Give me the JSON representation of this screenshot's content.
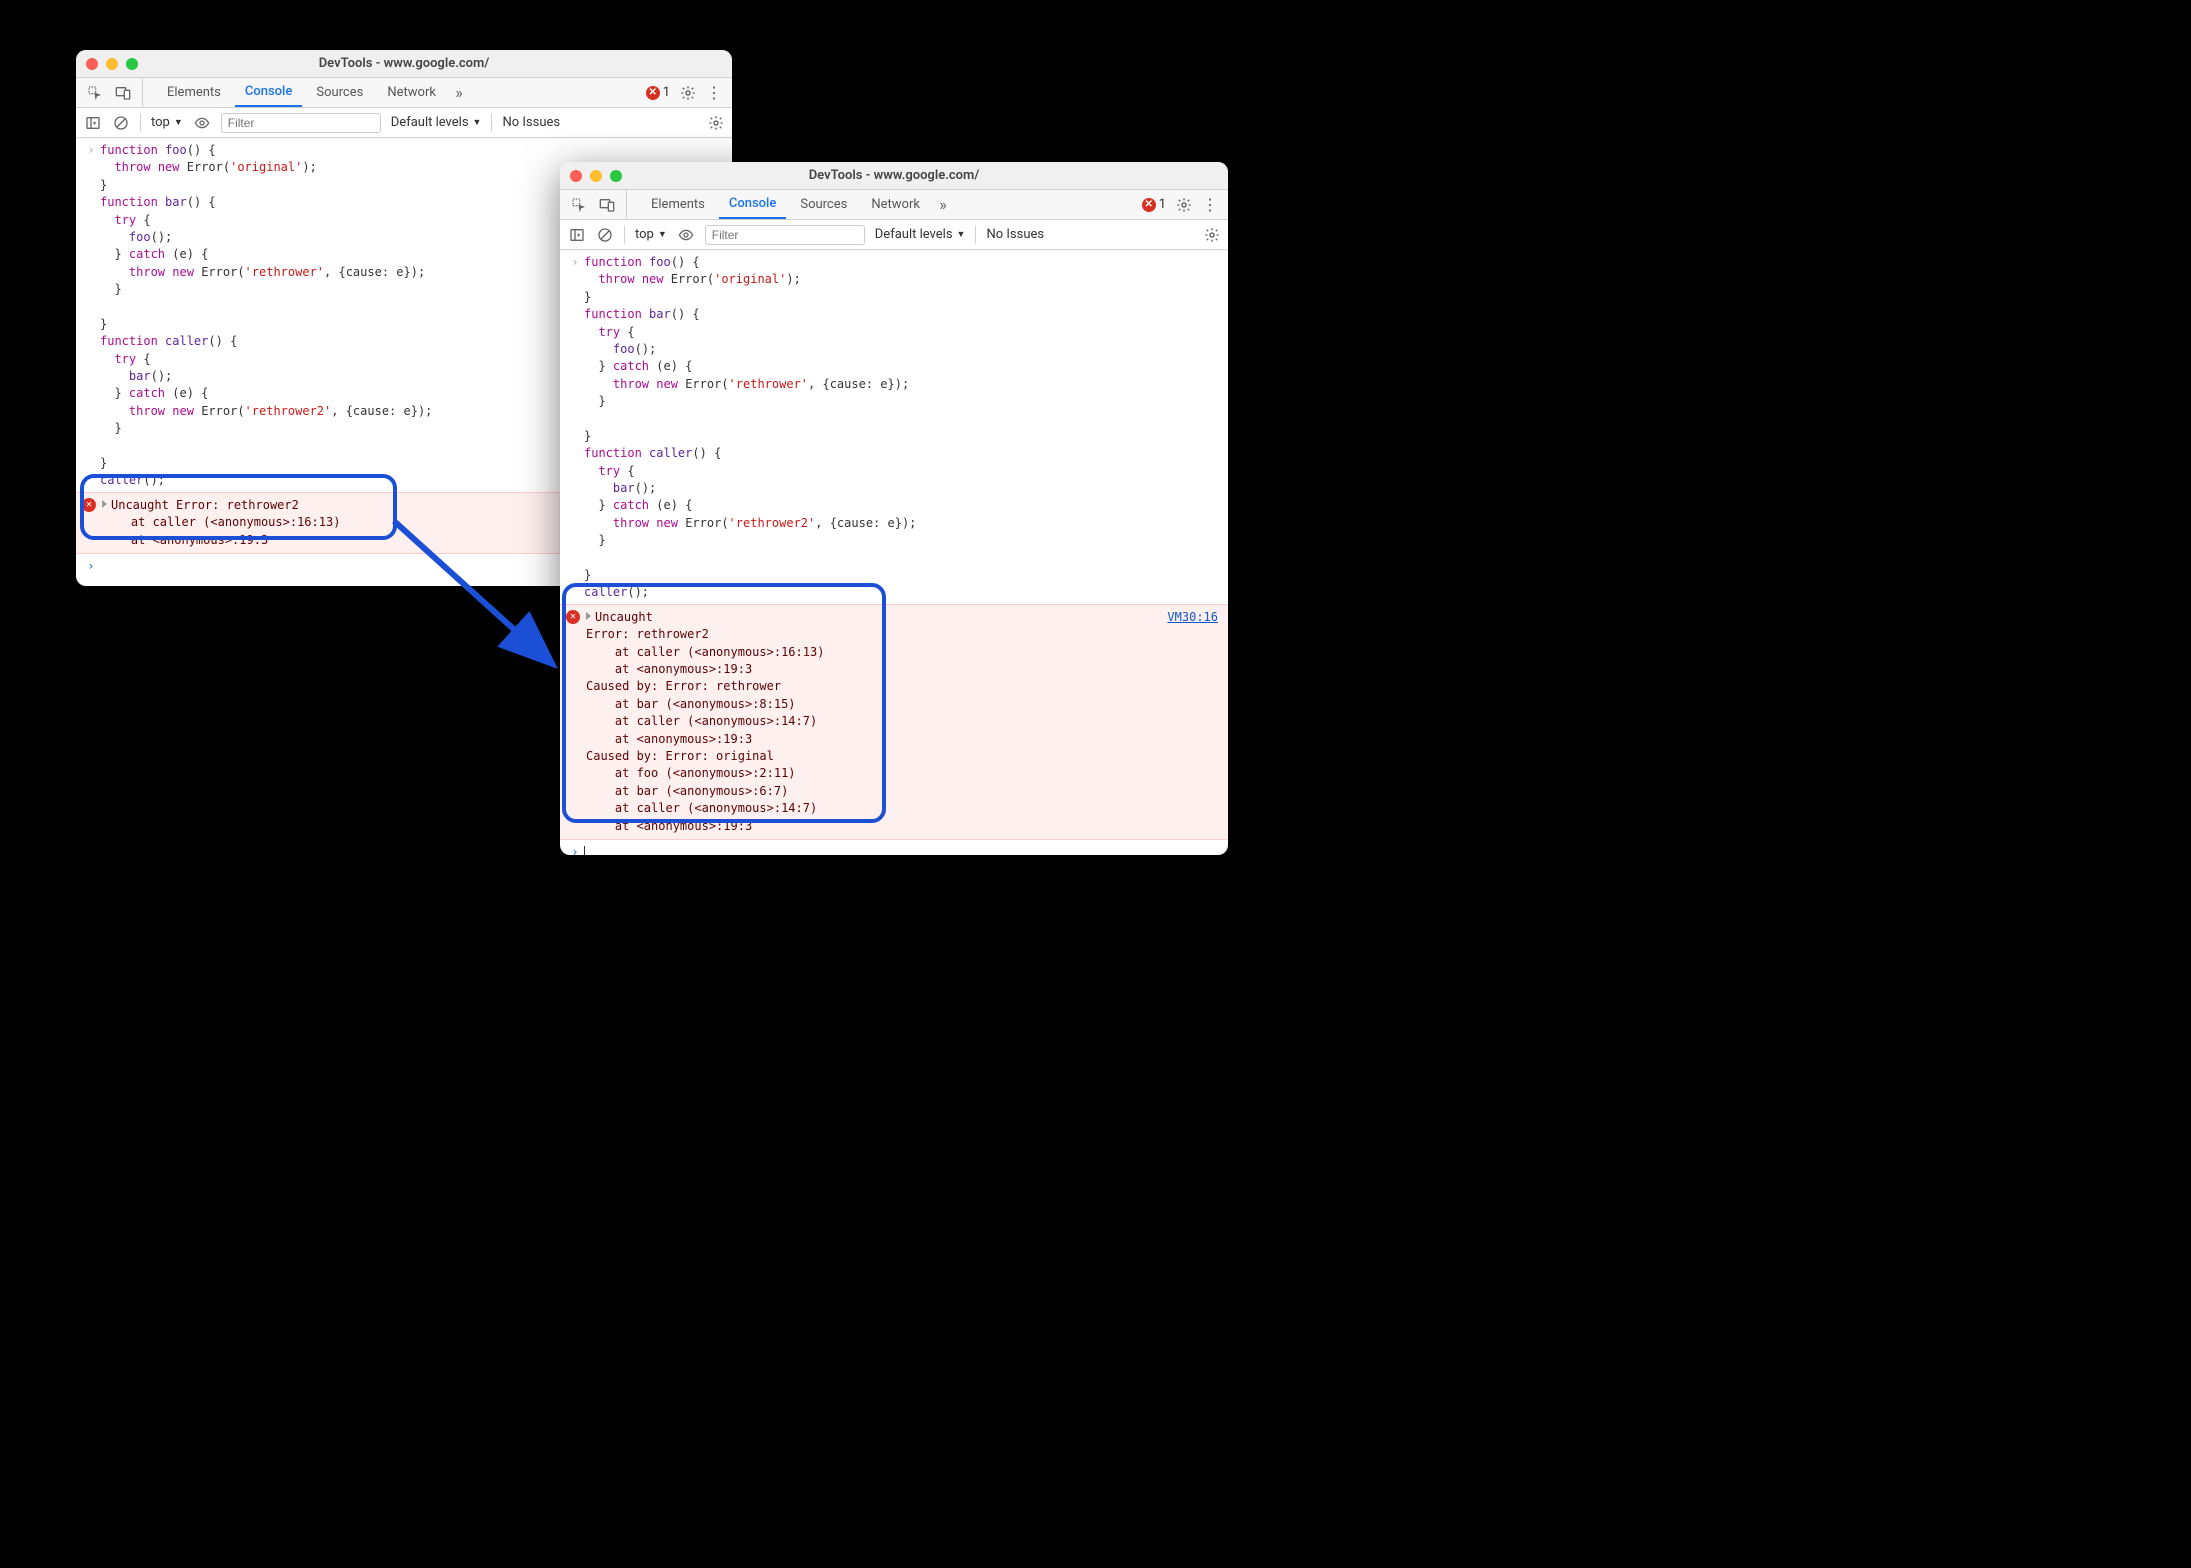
{
  "window1": {
    "title": "DevTools - www.google.com/",
    "tabs": [
      "Elements",
      "Console",
      "Sources",
      "Network"
    ],
    "activeTab": "Console",
    "errorCount": "1",
    "filterbar": {
      "context": "top",
      "filterPlaceholder": "Filter",
      "levels": "Default levels",
      "issues": "No Issues"
    },
    "code": "function foo() {\n  throw new Error('original');\n}\nfunction bar() {\n  try {\n    foo();\n  } catch (e) {\n    throw new Error('rethrower', {cause: e});\n  }\n\n}\nfunction caller() {\n  try {\n    bar();\n  } catch (e) {\n    throw new Error('rethrower2', {cause: e});\n  }\n\n}\ncaller();",
    "error": "Uncaught Error: rethrower2\n    at caller (<anonymous>:16:13)\n    at <anonymous>:19:3"
  },
  "window2": {
    "title": "DevTools - www.google.com/",
    "tabs": [
      "Elements",
      "Console",
      "Sources",
      "Network"
    ],
    "activeTab": "Console",
    "errorCount": "1",
    "filterbar": {
      "context": "top",
      "filterPlaceholder": "Filter",
      "levels": "Default levels",
      "issues": "No Issues"
    },
    "code": "function foo() {\n  throw new Error('original');\n}\nfunction bar() {\n  try {\n    foo();\n  } catch (e) {\n    throw new Error('rethrower', {cause: e});\n  }\n\n}\nfunction caller() {\n  try {\n    bar();\n  } catch (e) {\n    throw new Error('rethrower2', {cause: e});\n  }\n\n}\ncaller();",
    "error": "Uncaught\nError: rethrower2\n    at caller (<anonymous>:16:13)\n    at <anonymous>:19:3\nCaused by: Error: rethrower\n    at bar (<anonymous>:8:15)\n    at caller (<anonymous>:14:7)\n    at <anonymous>:19:3\nCaused by: Error: original\n    at foo (<anonymous>:2:11)\n    at bar (<anonymous>:6:7)\n    at caller (<anonymous>:14:7)\n    at <anonymous>:19:3",
    "errorLink": "VM30:16"
  }
}
